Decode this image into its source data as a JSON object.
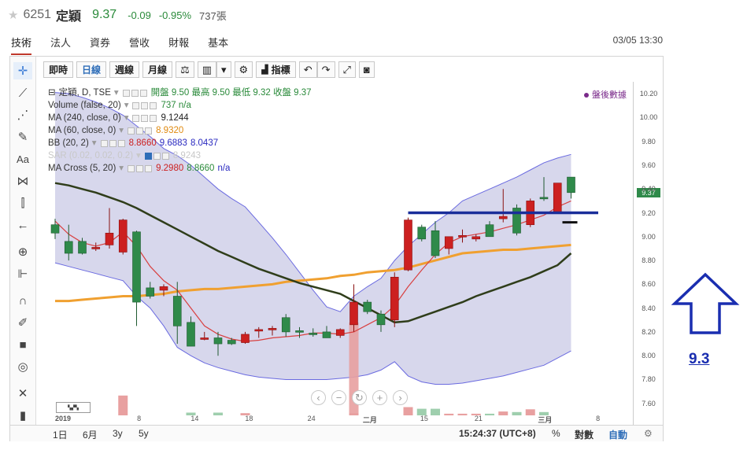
{
  "header": {
    "code": "6251",
    "name": "定穎",
    "price": "9.37",
    "change": "-0.09",
    "change_pct": "-0.95%",
    "volume": "737張"
  },
  "tabs": [
    "技術",
    "法人",
    "資券",
    "營收",
    "財報",
    "基本"
  ],
  "active_tab": "技術",
  "datetime": "03/05 13:30",
  "toolbar": {
    "buttons": [
      "即時",
      "日線",
      "週線",
      "月線"
    ],
    "active": "日線",
    "indicator_label": "指標"
  },
  "legend": {
    "title": "定穎, D, TSE",
    "ohlc_text": "開盤 9.50 最高 9.50 最低 9.32 收盤 9.37",
    "volume_label": "Volume (false, 20)",
    "volume_value": "737 n/a",
    "ma240_label": "MA (240, close, 0)",
    "ma240_value": "9.1244",
    "ma60_label": "MA (60, close, 0)",
    "ma60_value": "8.9320",
    "bb_label": "BB (20, 2)",
    "bb_v1": "8.8660",
    "bb_v2": "9.6883",
    "bb_v3": "8.0437",
    "sar_label": "SAR (0.02, 0.02, 0.2)",
    "sar_value": "8.9243",
    "cross_label": "MA Cross (5, 20)",
    "cross_v1": "9.2980",
    "cross_v2": "8.8660",
    "cross_v3": "n/a"
  },
  "after_hours": "盤後數據",
  "price_tag": "9.37",
  "bottom": {
    "ranges": [
      "1日",
      "6月",
      "3y",
      "5y"
    ],
    "clock": "15:24:37 (UTC+8)",
    "pct": "%",
    "log": "對數",
    "auto": "自動"
  },
  "annotation": {
    "target": "9.3",
    "arrow_color": "#1a2eb0",
    "hline_color": "#1a2e9a"
  },
  "colors": {
    "up": "#cc2020",
    "down": "#2f8a4a",
    "band": "#c9c9e6",
    "band_line": "#6a6ae0",
    "ma60": "#f0a030",
    "ma240": "#2f3d1a",
    "cross5": "#d84040"
  },
  "chart_data": {
    "type": "candlestick",
    "ylim": [
      7.42,
      10.3
    ],
    "y_ticks": [
      7.6,
      7.8,
      8.0,
      8.2,
      8.4,
      8.6,
      8.8,
      9.0,
      9.2,
      9.4,
      9.6,
      9.8,
      10.0,
      10.2
    ],
    "x_labels": [
      "2019",
      "8",
      "14",
      "18",
      "24",
      "二月",
      "15",
      "21",
      "三月",
      "8"
    ],
    "candles": [
      {
        "o": 9.1,
        "h": 9.15,
        "l": 8.98,
        "c": 9.03
      },
      {
        "o": 8.96,
        "h": 9.1,
        "l": 8.8,
        "c": 8.86
      },
      {
        "o": 8.96,
        "h": 8.99,
        "l": 8.85,
        "c": 8.86
      },
      {
        "o": 8.9,
        "h": 8.95,
        "l": 8.88,
        "c": 8.91
      },
      {
        "o": 8.93,
        "h": 9.24,
        "l": 8.9,
        "c": 9.03
      },
      {
        "o": 8.87,
        "h": 9.15,
        "l": 8.85,
        "c": 9.14
      },
      {
        "o": 9.04,
        "h": 9.05,
        "l": 8.25,
        "c": 8.45
      },
      {
        "o": 8.57,
        "h": 8.62,
        "l": 8.48,
        "c": 8.5
      },
      {
        "o": 8.55,
        "h": 8.6,
        "l": 8.5,
        "c": 8.58
      },
      {
        "o": 8.5,
        "h": 8.62,
        "l": 8.1,
        "c": 8.25
      },
      {
        "o": 8.28,
        "h": 8.33,
        "l": 8.08,
        "c": 8.08
      },
      {
        "o": 8.15,
        "h": 8.2,
        "l": 8.13,
        "c": 8.15
      },
      {
        "o": 8.15,
        "h": 8.2,
        "l": 8.0,
        "c": 8.1
      },
      {
        "o": 8.13,
        "h": 8.15,
        "l": 8.09,
        "c": 8.1
      },
      {
        "o": 8.11,
        "h": 8.2,
        "l": 8.1,
        "c": 8.18
      },
      {
        "o": 8.21,
        "h": 8.24,
        "l": 8.15,
        "c": 8.22
      },
      {
        "o": 8.22,
        "h": 8.25,
        "l": 8.17,
        "c": 8.23
      },
      {
        "o": 8.32,
        "h": 8.35,
        "l": 8.16,
        "c": 8.2
      },
      {
        "o": 8.21,
        "h": 8.24,
        "l": 8.15,
        "c": 8.2
      },
      {
        "o": 8.19,
        "h": 8.23,
        "l": 8.16,
        "c": 8.18
      },
      {
        "o": 8.2,
        "h": 8.25,
        "l": 8.15,
        "c": 8.15
      },
      {
        "o": 8.17,
        "h": 8.23,
        "l": 8.15,
        "c": 8.22
      },
      {
        "o": 8.26,
        "h": 8.6,
        "l": 8.2,
        "c": 8.45
      },
      {
        "o": 8.45,
        "h": 8.47,
        "l": 8.35,
        "c": 8.37
      },
      {
        "o": 8.35,
        "h": 8.38,
        "l": 8.2,
        "c": 8.26
      },
      {
        "o": 8.3,
        "h": 8.7,
        "l": 8.24,
        "c": 8.66
      },
      {
        "o": 8.72,
        "h": 9.16,
        "l": 8.71,
        "c": 9.14
      },
      {
        "o": 9.08,
        "h": 9.1,
        "l": 8.96,
        "c": 8.98
      },
      {
        "o": 9.05,
        "h": 9.13,
        "l": 8.82,
        "c": 8.84
      },
      {
        "o": 8.9,
        "h": 9.0,
        "l": 8.85,
        "c": 9.0
      },
      {
        "o": 9.0,
        "h": 9.06,
        "l": 8.95,
        "c": 9.01
      },
      {
        "o": 8.98,
        "h": 9.02,
        "l": 8.96,
        "c": 9.0
      },
      {
        "o": 9.1,
        "h": 9.13,
        "l": 9.0,
        "c": 9.0
      },
      {
        "o": 9.15,
        "h": 9.4,
        "l": 9.12,
        "c": 9.17
      },
      {
        "o": 9.24,
        "h": 9.27,
        "l": 9.01,
        "c": 9.03
      },
      {
        "o": 9.1,
        "h": 9.32,
        "l": 9.08,
        "c": 9.3
      },
      {
        "o": 9.33,
        "h": 9.5,
        "l": 9.3,
        "c": 9.32
      },
      {
        "o": 9.2,
        "h": 9.45,
        "l": 9.2,
        "c": 9.45
      },
      {
        "o": 9.5,
        "h": 9.5,
        "l": 9.32,
        "c": 9.37
      }
    ],
    "volume": [
      0,
      0,
      0,
      0,
      0,
      3.6,
      0,
      0,
      0,
      0,
      0.5,
      0,
      0.5,
      0,
      0.4,
      0,
      0,
      0,
      0,
      0,
      0,
      0,
      0.4,
      0,
      0,
      0,
      1.5,
      1.2,
      1.2,
      0.3,
      0.3,
      0.3,
      0.3,
      0.7,
      0.6,
      1.1,
      0.6,
      0,
      0
    ],
    "volume_spike": {
      "candle_index": 22,
      "value": 10
    },
    "ma60": [
      8.46,
      8.46,
      8.47,
      8.48,
      8.49,
      8.5,
      8.5,
      8.51,
      8.52,
      8.54,
      8.55,
      8.56,
      8.56,
      8.57,
      8.58,
      8.59,
      8.6,
      8.62,
      8.63,
      8.64,
      8.65,
      8.67,
      8.68,
      8.7,
      8.71,
      8.72,
      8.74,
      8.77,
      8.8,
      8.83,
      8.86,
      8.87,
      8.88,
      8.89,
      8.89,
      8.9,
      8.91,
      8.92,
      8.93
    ],
    "ma240": [
      9.45,
      9.43,
      9.4,
      9.37,
      9.33,
      9.29,
      9.24,
      9.18,
      9.12,
      9.06,
      9.0,
      8.94,
      8.88,
      8.83,
      8.78,
      8.73,
      8.69,
      8.65,
      8.61,
      8.58,
      8.55,
      8.52,
      8.46,
      8.4,
      8.34,
      8.28,
      8.29,
      8.33,
      8.37,
      8.41,
      8.45,
      8.5,
      8.54,
      8.58,
      8.62,
      8.66,
      8.71,
      8.76,
      8.86
    ],
    "bb_upper": [
      10.21,
      10.2,
      10.17,
      10.13,
      10.08,
      10.02,
      9.93,
      9.84,
      9.74,
      9.68,
      9.6,
      9.5,
      9.4,
      9.32,
      9.25,
      9.12,
      8.99,
      8.85,
      8.7,
      8.55,
      8.41,
      8.37,
      8.5,
      8.58,
      8.65,
      8.8,
      8.92,
      9.02,
      9.12,
      9.2,
      9.3,
      9.35,
      9.4,
      9.45,
      9.5,
      9.56,
      9.62,
      9.66,
      9.69
    ],
    "bb_lower": [
      8.78,
      8.75,
      8.72,
      8.69,
      8.66,
      8.63,
      8.5,
      8.4,
      8.25,
      8.07,
      8.0,
      7.94,
      7.9,
      7.87,
      7.84,
      7.82,
      7.81,
      7.8,
      7.8,
      7.8,
      7.8,
      7.81,
      7.82,
      7.84,
      7.88,
      7.95,
      7.83,
      7.78,
      7.76,
      7.76,
      7.77,
      7.79,
      7.81,
      7.83,
      7.86,
      7.89,
      7.92,
      7.98,
      8.04
    ],
    "ma_cross5": [
      9.13,
      9.02,
      8.95,
      8.92,
      8.95,
      9.04,
      8.92,
      8.75,
      8.63,
      8.55,
      8.4,
      8.25,
      8.18,
      8.14,
      8.12,
      8.13,
      8.15,
      8.16,
      8.17,
      8.19,
      8.19,
      8.18,
      8.2,
      8.26,
      8.32,
      8.42,
      8.58,
      8.72,
      8.85,
      8.95,
      9.0,
      9.02,
      9.04,
      9.07,
      9.1,
      9.14,
      9.18,
      9.25,
      9.3
    ],
    "sar_dot": {
      "candle_index": 38,
      "value": 9.12
    },
    "horizontal_line": {
      "from_index": 26,
      "to_index": 40,
      "value": 9.2
    }
  }
}
